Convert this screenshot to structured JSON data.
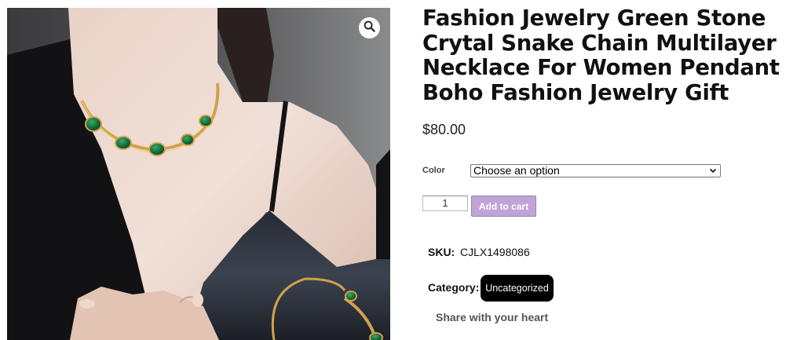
{
  "product": {
    "title": "Fashion Jewelry Green Stone Crytal Snake Chain Multilayer Necklace For Women Pendant Boho Fashion Jewelry Gift",
    "price": "$80.00",
    "image_alt": "woman wearing gold chain necklace with green oval stones"
  },
  "gallery": {
    "zoom_icon": "magnifier-icon"
  },
  "variation": {
    "label": "Color",
    "selected": "Choose an option"
  },
  "cart": {
    "quantity": "1",
    "add_label": "Add to cart"
  },
  "meta": {
    "sku_label": "SKU:",
    "sku_value": "CJLX1498086",
    "category_label": "Category:",
    "category_value": "Uncategorized"
  },
  "share": {
    "label": "Share with your heart"
  },
  "colors": {
    "button_bg": "#bfa4d8",
    "badge_bg": "#000000",
    "stone": "#0f6b3a",
    "gold": "#d1a24a"
  }
}
